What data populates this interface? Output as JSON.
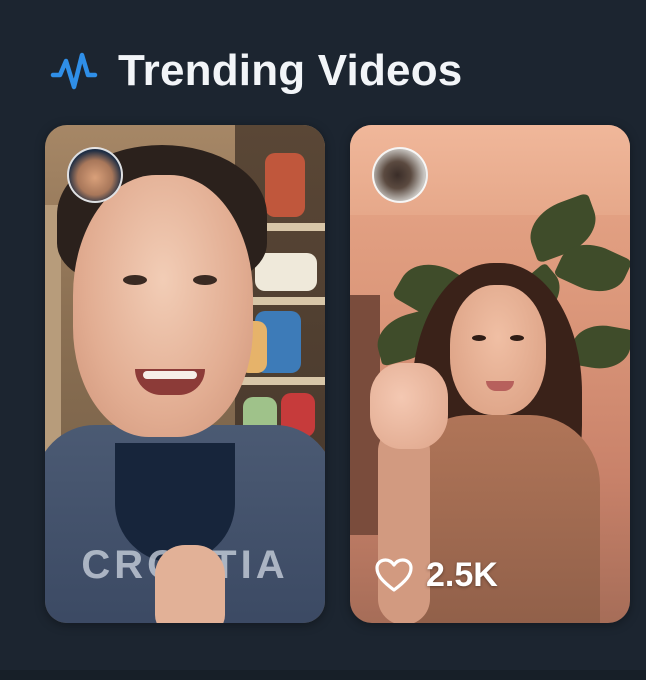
{
  "section": {
    "title": "Trending Videos",
    "icon": "waveform-icon",
    "accent_color": "#2f8fe8"
  },
  "videos": [
    {
      "avatar": "creator-avatar",
      "hoodie_text": "CROATIA",
      "likes": ""
    },
    {
      "avatar": "creator-avatar",
      "likes": "2.5K",
      "likes_icon": "heart-outline-icon"
    }
  ],
  "colors": {
    "background": "#1c2530",
    "text": "#f2f5f8"
  }
}
